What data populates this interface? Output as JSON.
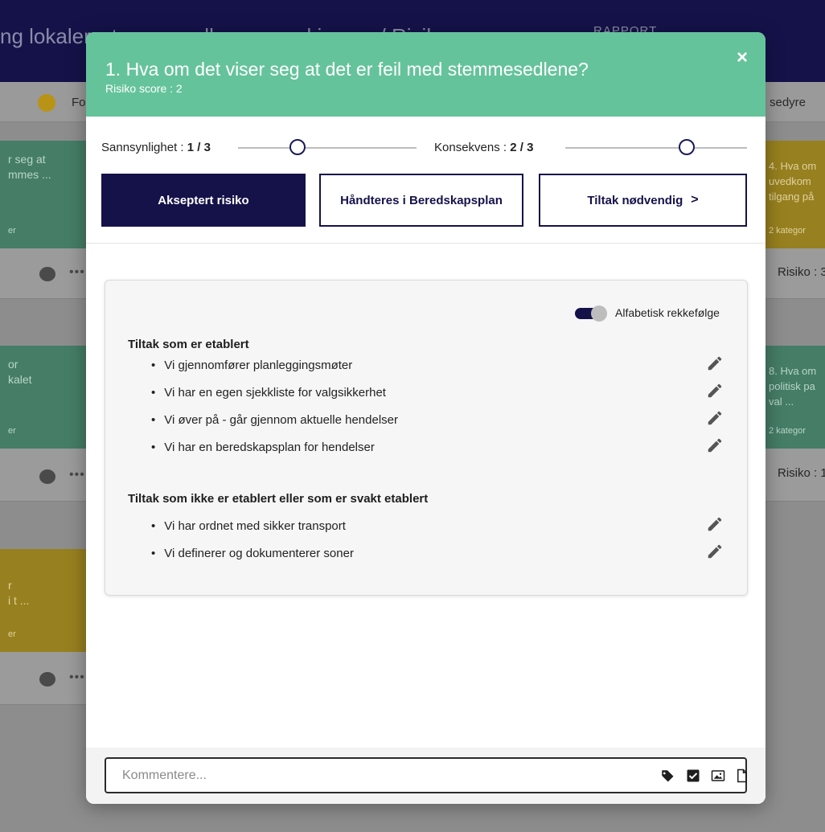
{
  "background": {
    "title": "ng lokaler, stemmesedler og maskinvare / Risiko",
    "report_label": "RAPPORT",
    "filter_left": "Fo",
    "filter_right": "sedyre",
    "cards_left": [
      {
        "line1": "r seg at",
        "line2": "mmes ...",
        "cat": "er"
      },
      {
        "line1": "or",
        "line2": "kalet",
        "cat": "er"
      },
      {
        "line1": "r",
        "line2": "i t ...",
        "cat": "er"
      }
    ],
    "cards_right": [
      {
        "line1": "4. Hva om",
        "line2": "uvedkom",
        "line3": "tilgang på",
        "cat": "2 kategor"
      },
      {
        "line1": "8. Hva om",
        "line2": "politisk pa",
        "line3": "val ...",
        "cat": "2 kategor"
      }
    ],
    "risk_right": [
      "Risiko : 3",
      "Risiko : 1"
    ]
  },
  "modal": {
    "title": "1. Hva om det viser seg at det er feil med stemmesedlene?",
    "subtitle": "Risiko score : 2",
    "close": "×",
    "probability": {
      "label": "Sannsynlighet : ",
      "value": "1 / 3",
      "level": 1,
      "max": 3
    },
    "consequence": {
      "label": "Konsekvens : ",
      "value": "2 / 3",
      "level": 2,
      "max": 3
    },
    "buttons": {
      "accepted": "Akseptert risiko",
      "preparedness": "Håndteres i Beredskapsplan",
      "action": "Tiltak nødvendig",
      "action_chevron": ">"
    },
    "toggle": {
      "label": "Alfabetisk rekkefølge",
      "on": true
    },
    "established_heading": "Tiltak som er etablert",
    "established": [
      "Vi gjennomfører planleggingsmøter",
      "Vi har en egen sjekkliste for valgsikkerhet",
      "Vi øver på - går gjennom aktuelle hendelser",
      "Vi har en beredskapsplan for hendelser"
    ],
    "not_established_heading": "Tiltak som ikke er etablert eller som er svakt etablert",
    "not_established": [
      "Vi har ordnet med sikker transport",
      "Vi definerer og dokumenterer soner"
    ],
    "comment_placeholder": "Kommentere...",
    "icons": [
      "tag-icon",
      "checkbox-icon",
      "image-icon",
      "file-icon",
      "pencil-icon",
      "chat-bubble-icon",
      "more-icon"
    ],
    "colors": {
      "header": "#65c39b",
      "navy": "#15124a"
    }
  }
}
